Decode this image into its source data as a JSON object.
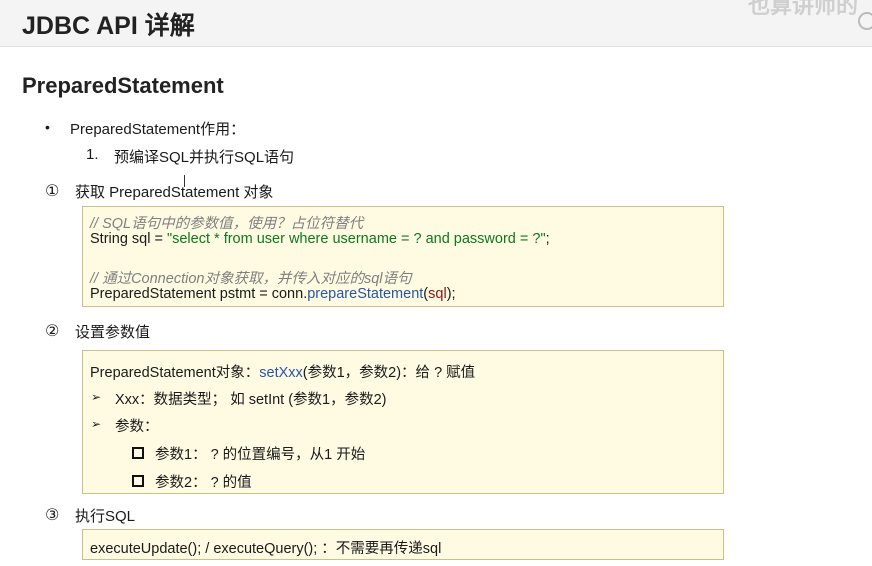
{
  "header": {
    "title": "JDBC API 详解",
    "watermark": "也算讲师的"
  },
  "section": {
    "title": "PreparedStatement",
    "bullet": "PreparedStatement作用：",
    "numbered_marker": "1.",
    "numbered_item": "预编译SQL并执行SQL语句"
  },
  "steps": [
    {
      "marker": "①",
      "title": "获取 PreparedStatement 对象"
    },
    {
      "marker": "②",
      "title": "设置参数值"
    },
    {
      "marker": "③",
      "title": "执行SQL"
    }
  ],
  "code1": {
    "comment1": "// SQL语句中的参数值，使用？占位符替代",
    "line1_prefix": "String sql = ",
    "line1_string": "\"select * from user where username = ? and password = ?\"",
    "line1_suffix": ";",
    "comment2": "// 通过Connection对象获取，并传入对应的sql语句",
    "line2_prefix": "PreparedStatement pstmt = conn.",
    "line2_method": "prepareStatement",
    "line2_open": "(",
    "line2_arg": "sql",
    "line2_close": ");"
  },
  "code2": {
    "line1_prefix": "PreparedStatement对象：",
    "line1_method": "setXxx",
    "line1_suffix": "(参数1，参数2)：给 ? 赋值",
    "arrow_symbol": "➢",
    "item1": "Xxx：数据类型； 如 setInt (参数1，参数2)",
    "item2": "参数：",
    "sub1": "参数1： ? 的位置编号，从1 开始",
    "sub2": "参数2： ? 的值"
  },
  "code3": {
    "line": "executeUpdate(); / executeQuery(); ：不需要再传递sql"
  }
}
